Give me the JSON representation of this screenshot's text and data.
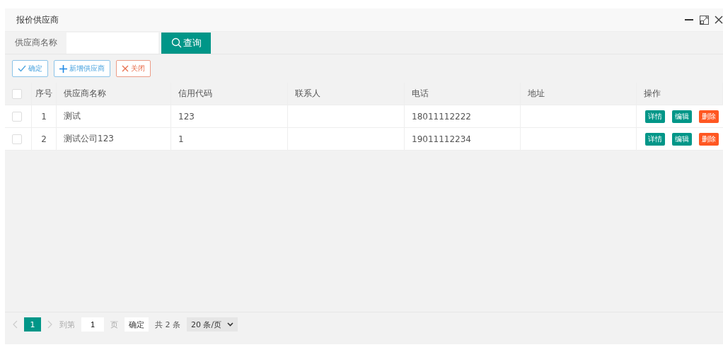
{
  "window": {
    "title": "报价供应商"
  },
  "search": {
    "label": "供应商名称",
    "button": "查询"
  },
  "toolbar": [
    {
      "kind": "confirm",
      "label": "确定"
    },
    {
      "kind": "add",
      "label": "新增供应商"
    },
    {
      "kind": "close",
      "label": "关闭"
    }
  ],
  "table": {
    "select_all_checked": false,
    "columns": [
      "序号",
      "供应商名称",
      "信用代码",
      "联系人",
      "电话",
      "地址",
      "操作"
    ],
    "rows": [
      {
        "checked": false,
        "cells": [
          "1",
          "测试",
          "123",
          "",
          "18011112222",
          ""
        ],
        "actions": [
          {
            "kind": "primary",
            "label": "详情"
          },
          {
            "kind": "primary",
            "label": "编辑"
          },
          {
            "kind": "danger",
            "label": "删除"
          }
        ]
      },
      {
        "checked": false,
        "cells": [
          "2",
          "测试公司123",
          "1",
          "",
          "19011112234",
          ""
        ],
        "actions": [
          {
            "kind": "primary",
            "label": "详情"
          },
          {
            "kind": "primary",
            "label": "编辑"
          },
          {
            "kind": "danger",
            "label": "删除"
          }
        ]
      }
    ]
  },
  "pagination": {
    "pages": [
      {
        "label": "1",
        "selected": true
      }
    ],
    "goto_prefix": "到第",
    "goto_value": "1",
    "goto_suffix": "页",
    "goto_button": "确定",
    "total": "共 2 条",
    "page_size": "20 条/页"
  }
}
